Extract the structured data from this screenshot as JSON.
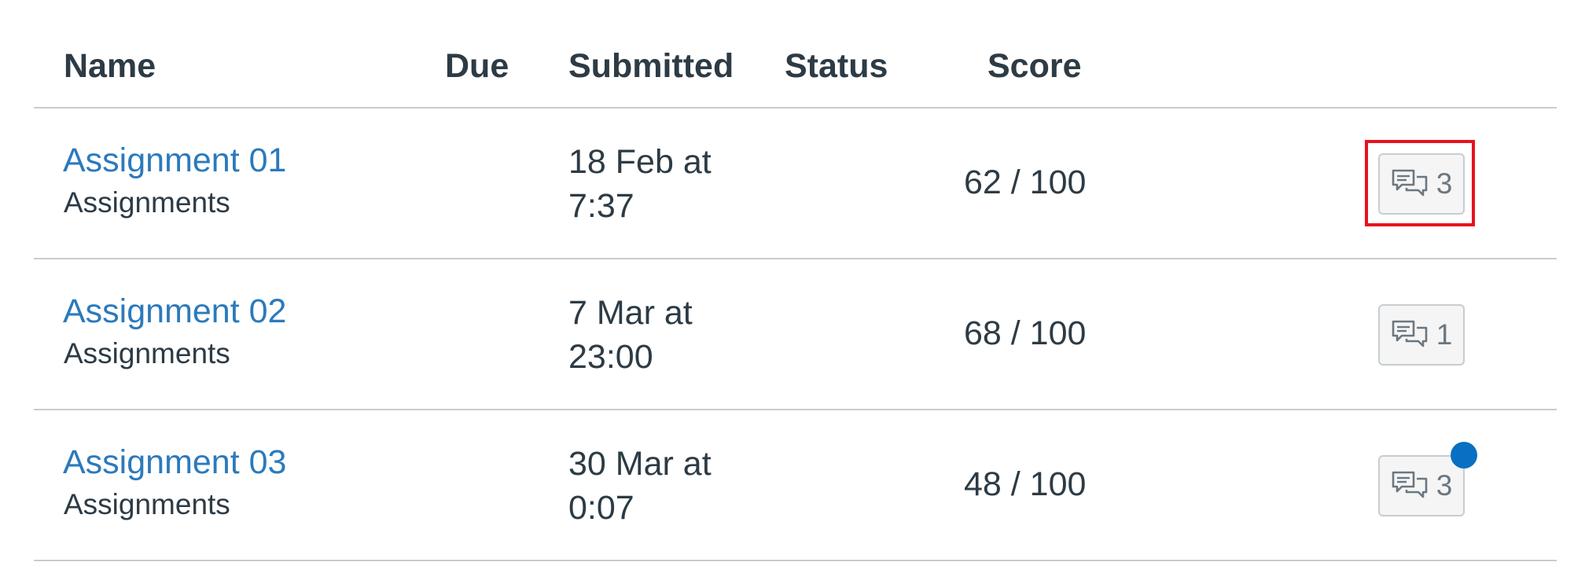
{
  "table": {
    "columns": [
      "Name",
      "Due",
      "Submitted",
      "Status",
      "Score"
    ]
  },
  "rows": [
    {
      "name": "Assignment 01",
      "type": "Assignments",
      "submitted_line1": "18 Feb at",
      "submitted_line2": "7:37",
      "score": "62 / 100",
      "comments": "3"
    },
    {
      "name": "Assignment 02",
      "type": "Assignments",
      "submitted_line1": "7 Mar at",
      "submitted_line2": "23:00",
      "score": "68 / 100",
      "comments": "1"
    },
    {
      "name": "Assignment 03",
      "type": "Assignments",
      "submitted_line1": "30 Mar at",
      "submitted_line2": "0:07",
      "score": "48 / 100",
      "comments": "3"
    }
  ],
  "colors": {
    "link": "#2b7abc",
    "text": "#2d3b45",
    "divider": "#c7cdd1",
    "highlight": "#e8121d",
    "unread_dot": "#0770c2"
  },
  "icons": {
    "comment_button": "comment-bubbles-icon"
  }
}
